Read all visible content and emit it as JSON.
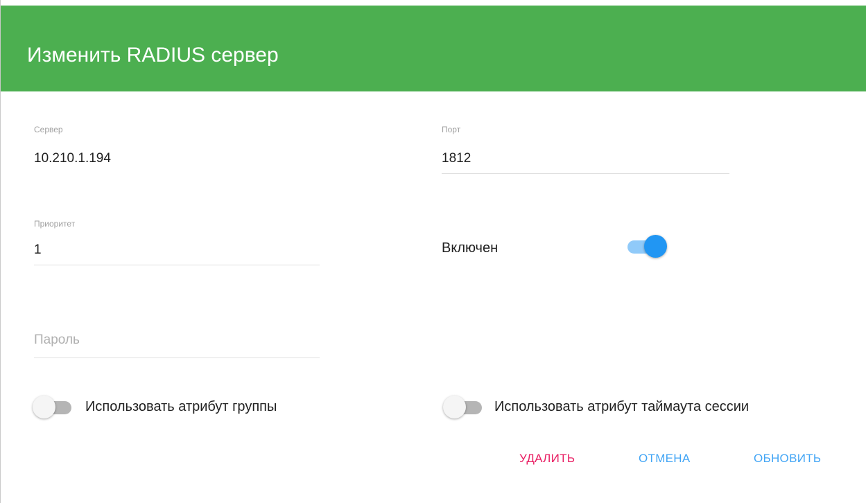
{
  "dialog": {
    "title": "Изменить RADIUS сервер",
    "header_color": "#4caf50"
  },
  "fields": {
    "server": {
      "label": "Сервер",
      "value": "10.210.1.194"
    },
    "port": {
      "label": "Порт",
      "value": "1812"
    },
    "priority": {
      "label": "Приоритет",
      "value": "1"
    },
    "password": {
      "placeholder": "Пароль",
      "value": ""
    }
  },
  "switches": {
    "enabled": {
      "label": "Включен",
      "state": "on",
      "color": "#2196f3"
    },
    "group_attribute": {
      "label": "Использовать атрибут группы",
      "state": "off"
    },
    "session_timeout_attribute": {
      "label": "Использовать атрибут таймаута сессии",
      "state": "off"
    }
  },
  "actions": {
    "delete": {
      "label": "УДАЛИТЬ",
      "color": "#e91e63"
    },
    "cancel": {
      "label": "ОТМЕНА",
      "color": "#42a5f5"
    },
    "update": {
      "label": "ОБНОВИТЬ",
      "color": "#42a5f5"
    }
  }
}
